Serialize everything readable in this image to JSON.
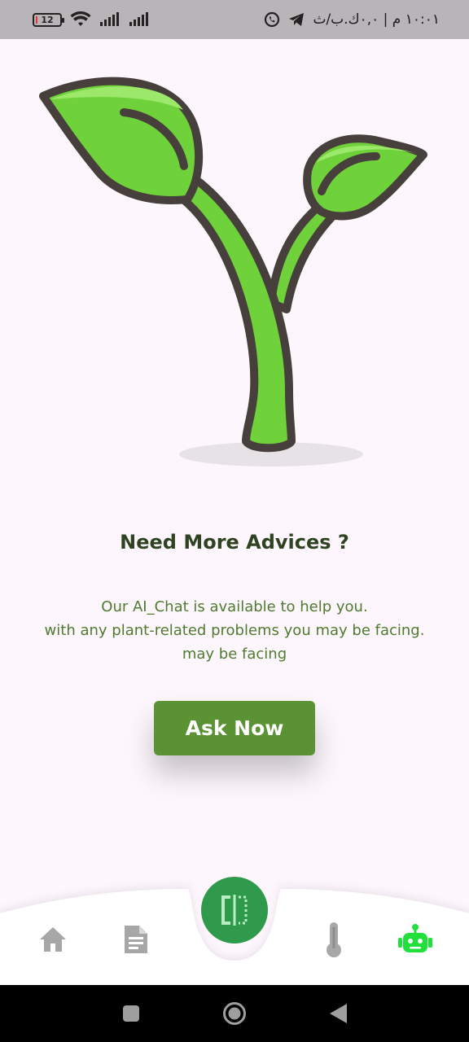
{
  "status_bar": {
    "battery_level": "12",
    "time": "١٠:٠١ م | ٠,٠ك.ب/ث"
  },
  "main": {
    "heading": "Need More Advices ?",
    "description_lines": [
      "Our AI_Chat is available to help you.",
      "with any plant-related problems you may be facing.",
      "may be facing"
    ],
    "ask_button_label": "Ask Now"
  },
  "bottom_nav": {
    "items": [
      {
        "icon": "home-icon",
        "active": false
      },
      {
        "icon": "document-icon",
        "active": false
      },
      {
        "icon": "scan-icon",
        "active": true
      },
      {
        "icon": "thermometer-icon",
        "active": false
      },
      {
        "icon": "robot-icon",
        "active": true
      }
    ]
  },
  "colors": {
    "primary_green": "#5a9234",
    "heading": "#2f4221",
    "text_green": "#4f7a2f",
    "fab": "#2f9a4c",
    "active_icon": "#22e03c",
    "inactive_icon": "#a7a7a7",
    "background": "#fdf7fd"
  }
}
